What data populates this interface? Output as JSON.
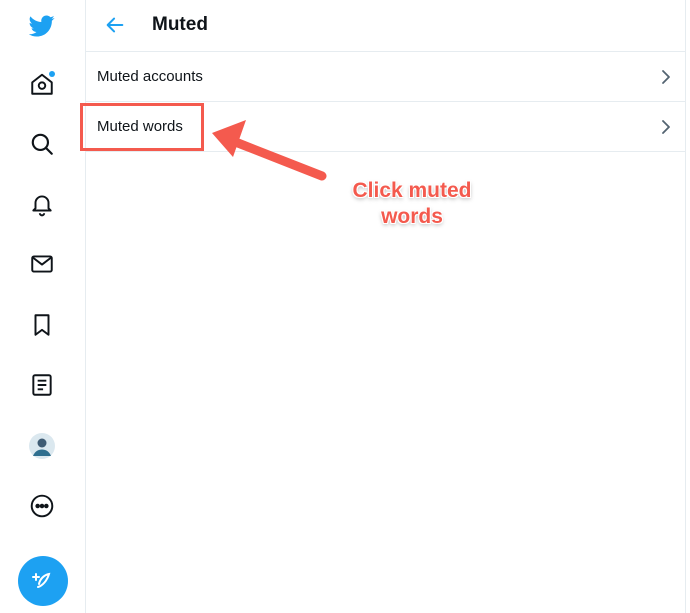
{
  "sidebar": {
    "items": [
      {
        "icon": "twitter-logo-icon"
      },
      {
        "icon": "home-icon",
        "has_notification": true
      },
      {
        "icon": "explore-search-icon"
      },
      {
        "icon": "notifications-bell-icon"
      },
      {
        "icon": "messages-envelope-icon"
      },
      {
        "icon": "bookmarks-icon"
      },
      {
        "icon": "lists-icon"
      },
      {
        "icon": "profile-avatar-icon"
      },
      {
        "icon": "more-options-icon"
      }
    ],
    "tweet_button_icon": "compose-tweet-icon"
  },
  "header": {
    "back_icon": "back-arrow-icon",
    "title": "Muted"
  },
  "rows": [
    {
      "label": "Muted accounts"
    },
    {
      "label": "Muted words"
    }
  ],
  "annotation": {
    "callout_line1": "Click muted",
    "callout_line2": "words",
    "color": "#f45a4e"
  },
  "colors": {
    "accent": "#1da1f2",
    "divider": "#e6ecf0",
    "text": "#0f1419"
  }
}
